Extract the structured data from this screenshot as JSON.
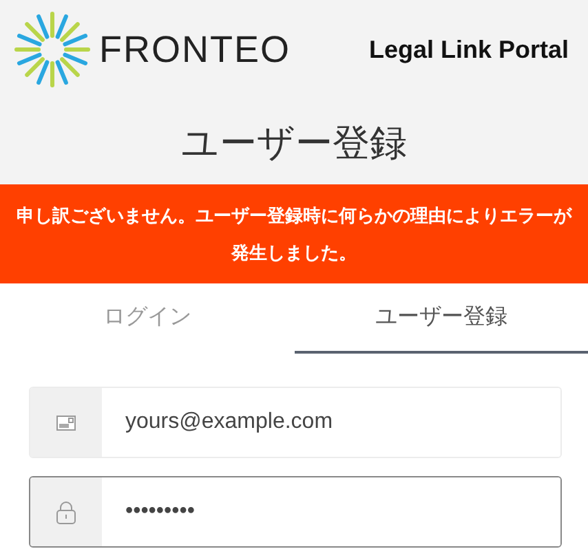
{
  "header": {
    "brand": "FRONTEO",
    "product": "Legal Link Portal",
    "title": "ユーザー登録"
  },
  "error": "申し訳ございません。ユーザー登録時に何らかの理由によりエラーが発生しました。",
  "tabs": [
    {
      "label": "ログイン",
      "selected": false
    },
    {
      "label": "ユーザー登録",
      "selected": true
    }
  ],
  "fields": [
    {
      "kind": "email",
      "value": "yours@example.com",
      "focused": false
    },
    {
      "kind": "password",
      "value": "•••••••••",
      "focused": true
    }
  ]
}
